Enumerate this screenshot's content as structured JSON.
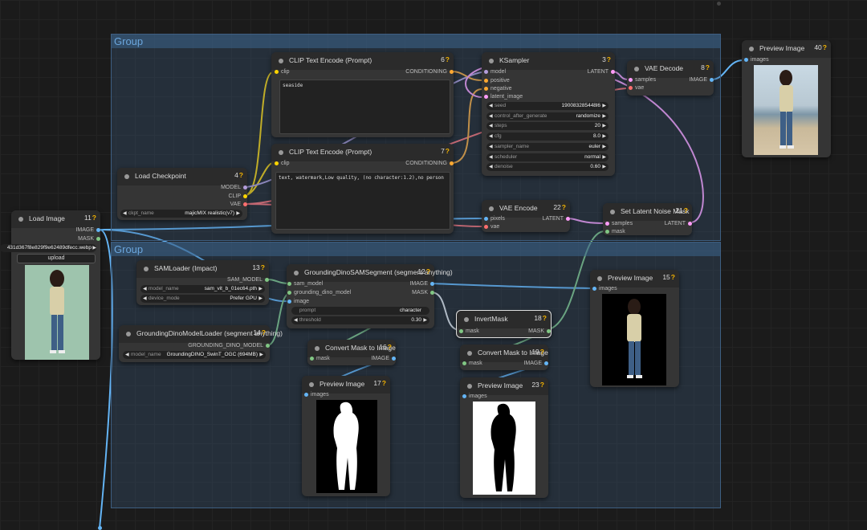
{
  "colors": {
    "model": "#b39ddb",
    "clip": "#ffd500",
    "vae": "#ff6e6e",
    "conditioning": "#ffa931",
    "latent": "#ff9cf9",
    "image": "#64b5f6",
    "mask": "#81c784",
    "sam": "#81c784",
    "group": "#3f6894"
  },
  "groups": {
    "top": {
      "title": "Group"
    },
    "bottom": {
      "title": "Group"
    }
  },
  "nodes": {
    "load_image": {
      "title": "Load Image",
      "id": "11",
      "outputs": [
        "IMAGE",
        "MASK"
      ],
      "filename": "431d367f8e829f9e62489dfecc.webp",
      "upload_label": "upload"
    },
    "load_checkpoint": {
      "title": "Load Checkpoint",
      "id": "4",
      "outputs": [
        "MODEL",
        "CLIP",
        "VAE"
      ],
      "widget": {
        "label": "ckpt_name",
        "value": "majicMIX realistic(v7)"
      }
    },
    "clip_pos": {
      "title": "CLIP Text Encode (Prompt)",
      "id": "6",
      "input": "clip",
      "output": "CONDITIONING",
      "text": "seaside"
    },
    "clip_neg": {
      "title": "CLIP Text Encode (Prompt)",
      "id": "7",
      "input": "clip",
      "output": "CONDITIONING",
      "text": "text, watermark,Low quality, (no character:1.2),no person"
    },
    "ksampler": {
      "title": "KSampler",
      "id": "3",
      "inputs": [
        "model",
        "positive",
        "negative",
        "latent_image"
      ],
      "output": "LATENT",
      "widgets": [
        {
          "label": "seed",
          "value": "190083285448l6"
        },
        {
          "label": "control_after_generate",
          "value": "randomize"
        },
        {
          "label": "steps",
          "value": "20"
        },
        {
          "label": "cfg",
          "value": "8.0"
        },
        {
          "label": "sampler_name",
          "value": "euler"
        },
        {
          "label": "scheduler",
          "value": "normal"
        },
        {
          "label": "denoise",
          "value": "0.60"
        }
      ]
    },
    "vae_decode": {
      "title": "VAE Decode",
      "id": "8",
      "inputs": [
        "samples",
        "vae"
      ],
      "output": "IMAGE"
    },
    "preview40": {
      "title": "Preview Image",
      "id": "40",
      "input": "images"
    },
    "vae_encode": {
      "title": "VAE Encode",
      "id": "22",
      "inputs": [
        "pixels",
        "vae"
      ],
      "output": "LATENT"
    },
    "set_latent_mask": {
      "title": "Set Latent Noise Mask",
      "id": "21",
      "inputs": [
        "samples",
        "mask"
      ],
      "output": "LATENT"
    },
    "sam_loader": {
      "title": "SAMLoader (Impact)",
      "id": "13",
      "output": "SAM_MODEL",
      "widgets": [
        {
          "label": "model_name",
          "value": "sam_vit_b_01ec64.pth"
        },
        {
          "label": "device_mode",
          "value": "Prefer GPU"
        }
      ]
    },
    "gdino_loader": {
      "title": "GroundingDinoModelLoader (segment anything)",
      "id": "14",
      "output": "GROUNDING_DINO_MODEL",
      "widget": {
        "label": "model_name",
        "value": "GroundingDINO_SwinT_OGC (694MB)"
      }
    },
    "gdino_segment": {
      "title": "GroundingDinoSAMSegment (segment anything)",
      "id": "12",
      "inputs": [
        "sam_model",
        "grounding_dino_model",
        "image"
      ],
      "outputs": [
        "IMAGE",
        "MASK"
      ],
      "widgets": [
        {
          "label": "prompt",
          "value": "character"
        },
        {
          "label": "threshold",
          "value": "0.30"
        }
      ]
    },
    "invert_mask": {
      "title": "InvertMask",
      "id": "18",
      "input": "mask",
      "output": "MASK"
    },
    "mask_to_img16": {
      "title": "Convert Mask to Image",
      "id": "16",
      "input": "mask",
      "output": "IMAGE"
    },
    "mask_to_img19": {
      "title": "Convert Mask to Image",
      "id": "19",
      "input": "mask",
      "output": "IMAGE"
    },
    "preview15": {
      "title": "Preview Image",
      "id": "15",
      "input": "images"
    },
    "preview17": {
      "title": "Preview Image",
      "id": "17",
      "input": "images"
    },
    "preview23": {
      "title": "Preview Image",
      "id": "23",
      "input": "images"
    }
  }
}
